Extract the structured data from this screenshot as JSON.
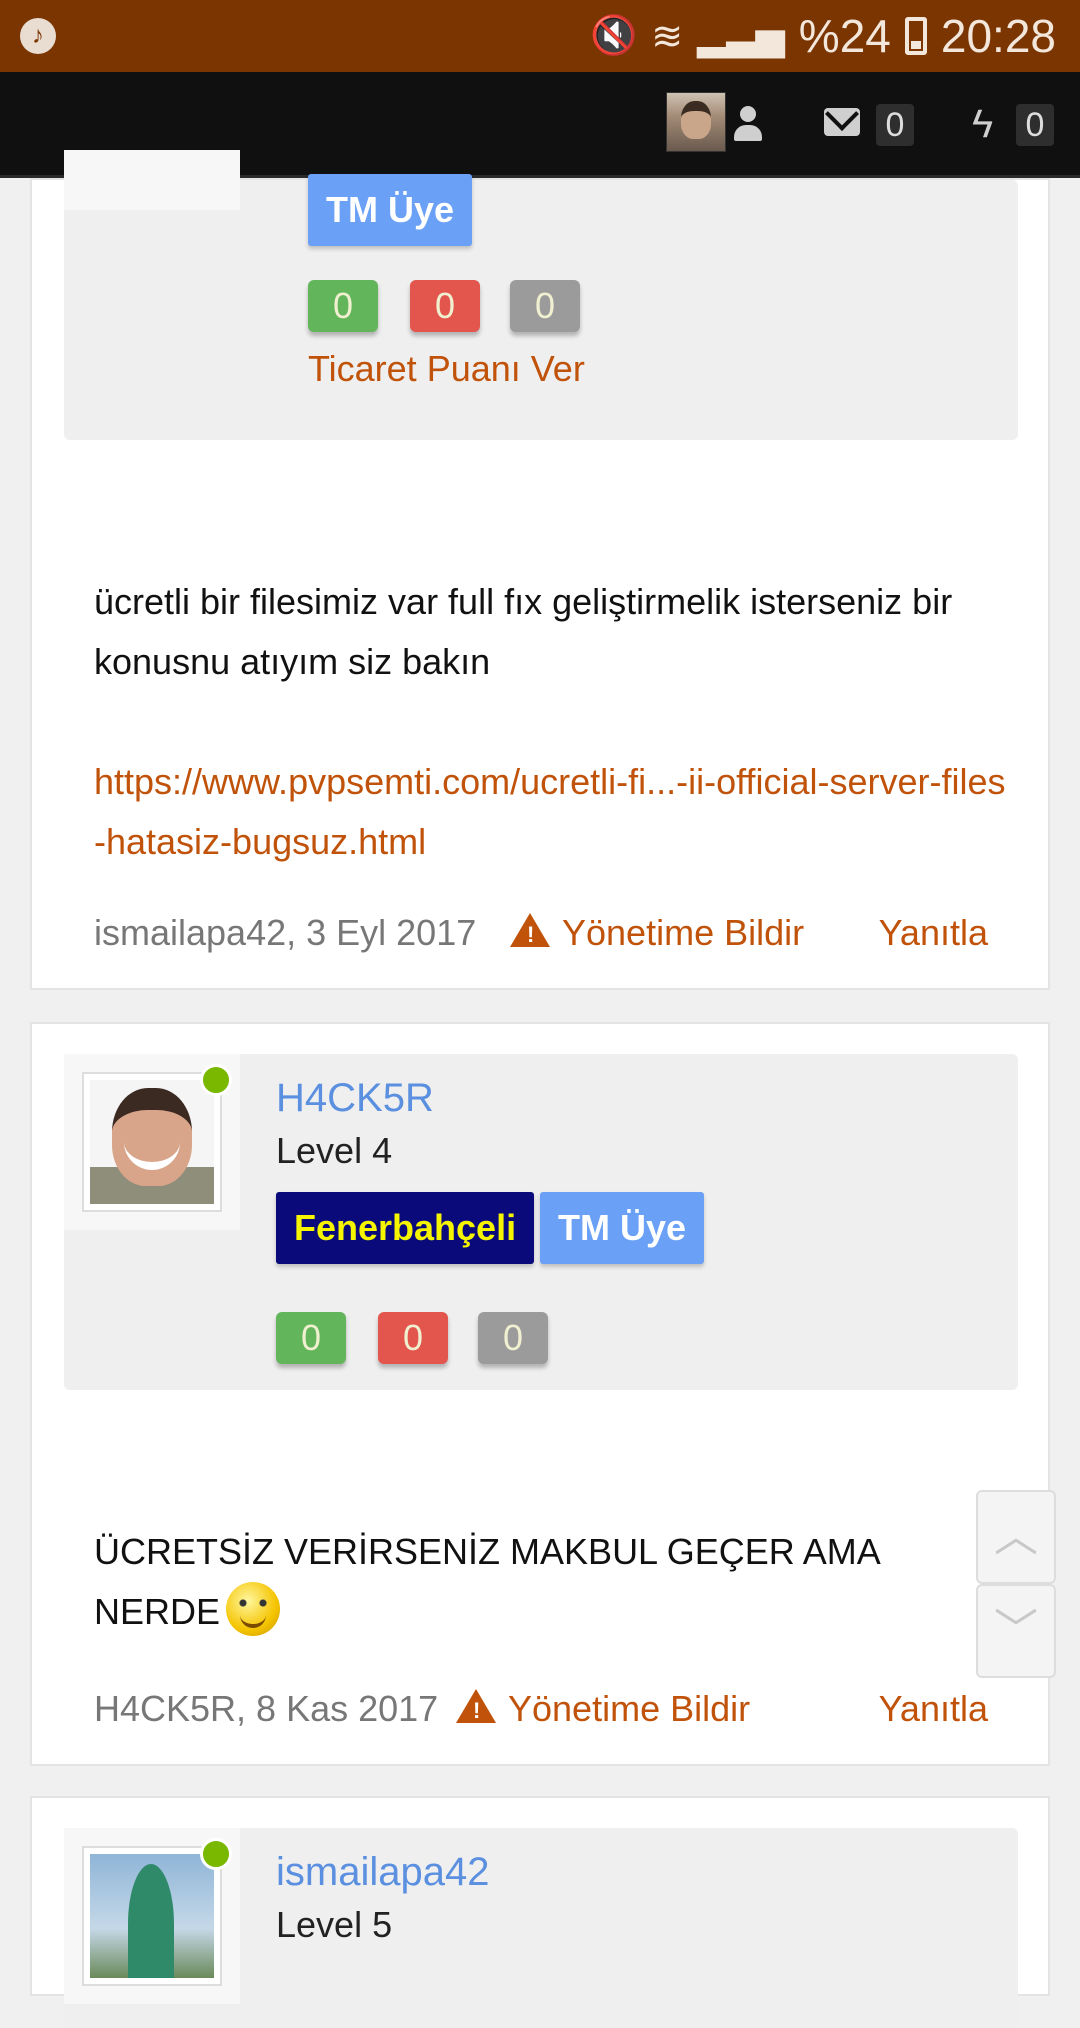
{
  "status_bar": {
    "battery": "%24",
    "time": "20:28"
  },
  "top_nav": {
    "messages_count": "0",
    "alerts_count": "0"
  },
  "post1": {
    "badge_tm": "TM Üye",
    "scores": [
      "0",
      "0",
      "0"
    ],
    "trade_link": "Ticaret Puanı Ver",
    "message": "ücretli bir filesimiz var full fıx geliştirmelik isterseniz bir konusnu atıyım siz bakın",
    "link": "https://www.pvpsemti.com/ucretli-fi...-ii-official-server-files-hatasiz-bugsuz.html",
    "meta": "ismailapa42, 3 Eyl 2017",
    "report": "Yönetime Bildir",
    "reply": "Yanıtla"
  },
  "post2": {
    "username": "H4CK5R",
    "level": "Level 4",
    "badge_team": "Fenerbahçeli",
    "badge_tm": "TM Üye",
    "scores": [
      "0",
      "0",
      "0"
    ],
    "message": "ÜCRETSİZ VERİRSENİZ MAKBUL GEÇER AMA NERDE",
    "meta": "H4CK5R, 8 Kas 2017",
    "report": "Yönetime Bildir",
    "reply": "Yanıtla"
  },
  "post3": {
    "username": "ismailapa42",
    "level": "Level 5"
  },
  "icons": {
    "status": [
      "music-icon",
      "mute-icon",
      "wifi-icon",
      "signal-icon",
      "battery-icon"
    ],
    "nav": [
      "user-icon",
      "envelope-icon",
      "bolt-icon"
    ],
    "scroll": [
      "chevron-up-icon",
      "chevron-down-icon"
    ]
  },
  "colors": {
    "status_bar": "#7a3500",
    "nav_bar": "#101010",
    "link": "#c0520a",
    "username": "#5b8fe0",
    "online": "#7ab800"
  }
}
